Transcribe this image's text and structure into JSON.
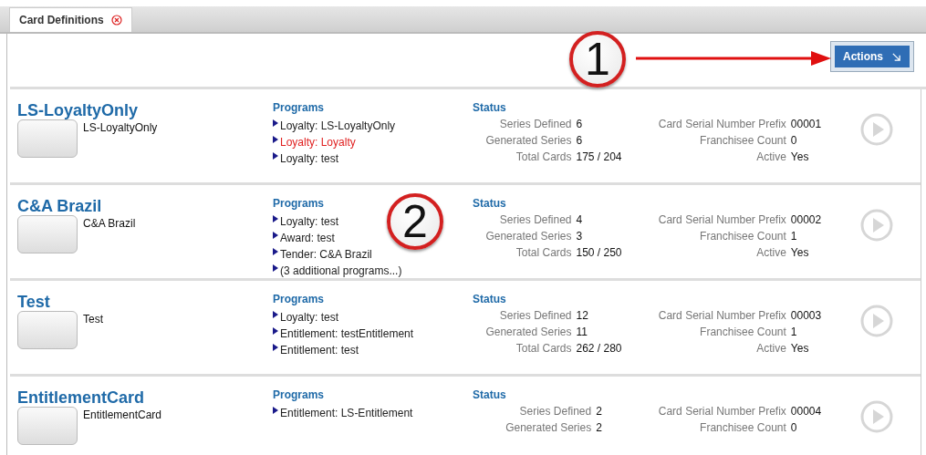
{
  "tabs": [
    {
      "label": "Card Definitions",
      "selected": true,
      "closable": true
    }
  ],
  "toolbar": {
    "actions_button": "Actions"
  },
  "callouts": [
    {
      "label": "1",
      "kind": "arrowed"
    },
    {
      "label": "2",
      "kind": "plain"
    }
  ],
  "cards": [
    {
      "name": "LS-LoyaltyOnly",
      "image_caption": "LS-LoyaltyOnly",
      "programs_heading": "Programs",
      "status_heading": "Status",
      "programs": [
        {
          "text": "Loyalty: LS-LoyaltyOnly",
          "highlighted": false
        },
        {
          "text": "Loyalty: Loyalty",
          "highlighted": true
        },
        {
          "text": "Loyalty: test",
          "highlighted": false
        }
      ],
      "status_left": [
        {
          "label": "Series Defined",
          "value": "6"
        },
        {
          "label": "Generated Series",
          "value": "6"
        },
        {
          "label": "Total Cards",
          "value": "175 / 204"
        }
      ],
      "status_right": [
        {
          "label": "Card Serial Number Prefix",
          "value": "00001"
        },
        {
          "label": "Franchisee Count",
          "value": "0"
        },
        {
          "label": "Active",
          "value": "Yes"
        }
      ]
    },
    {
      "name": "C&A Brazil",
      "image_caption": "C&A Brazil",
      "programs_heading": "Programs",
      "status_heading": "Status",
      "programs": [
        {
          "text": "Loyalty: test",
          "highlighted": false
        },
        {
          "text": "Award: test",
          "highlighted": false
        },
        {
          "text": "Tender: C&A Brazil",
          "highlighted": false
        },
        {
          "text": "(3 additional programs...)",
          "highlighted": false
        }
      ],
      "status_left": [
        {
          "label": "Series Defined",
          "value": "4"
        },
        {
          "label": "Generated Series",
          "value": "3"
        },
        {
          "label": "Total Cards",
          "value": "150 / 250"
        }
      ],
      "status_right": [
        {
          "label": "Card Serial Number Prefix",
          "value": "00002"
        },
        {
          "label": "Franchisee Count",
          "value": "1"
        },
        {
          "label": "Active",
          "value": "Yes"
        }
      ]
    },
    {
      "name": "Test",
      "image_caption": "Test",
      "programs_heading": "Programs",
      "status_heading": "Status",
      "programs": [
        {
          "text": "Loyalty: test",
          "highlighted": false
        },
        {
          "text": "Entitlement: testEntitlement",
          "highlighted": false
        },
        {
          "text": "Entitlement: test",
          "highlighted": false
        }
      ],
      "status_left": [
        {
          "label": "Series Defined",
          "value": "12"
        },
        {
          "label": "Generated Series",
          "value": "11"
        },
        {
          "label": "Total Cards",
          "value": "262 / 280"
        }
      ],
      "status_right": [
        {
          "label": "Card Serial Number Prefix",
          "value": "00003"
        },
        {
          "label": "Franchisee Count",
          "value": "1"
        },
        {
          "label": "Active",
          "value": "Yes"
        }
      ]
    },
    {
      "name": "EntitlementCard",
      "image_caption": "EntitlementCard",
      "programs_heading": "Programs",
      "status_heading": "Status",
      "programs": [
        {
          "text": "Entitlement: LS-Entitlement",
          "highlighted": false
        }
      ],
      "status_left": [
        {
          "label": "Series Defined",
          "value": "2"
        },
        {
          "label": "Generated Series",
          "value": "2"
        }
      ],
      "status_right": [
        {
          "label": "Card Serial Number Prefix",
          "value": "00004"
        },
        {
          "label": "Franchisee Count",
          "value": "0"
        }
      ]
    }
  ]
}
